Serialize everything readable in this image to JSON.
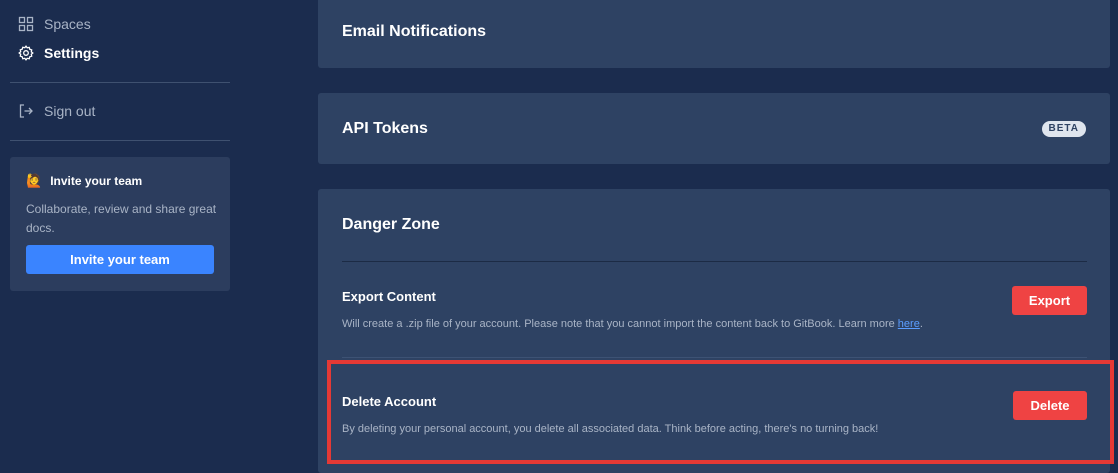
{
  "sidebar": {
    "items": [
      {
        "label": "Spaces",
        "icon": "grid-icon"
      },
      {
        "label": "Settings",
        "icon": "gear-icon",
        "active": true
      },
      {
        "label": "Sign out",
        "icon": "sign-out-icon"
      }
    ],
    "invite": {
      "emoji": "🙋",
      "title": "Invite your team",
      "description": "Collaborate, review and share great docs.",
      "button_label": "Invite your team"
    }
  },
  "main": {
    "email": {
      "title": "Email Notifications"
    },
    "api": {
      "title": "API Tokens",
      "badge": "BETA"
    },
    "danger": {
      "title": "Danger Zone",
      "export": {
        "title": "Export Content",
        "description": "Will create a .zip file of your account. Please note that you cannot import the content back to GitBook. Learn more ",
        "link": "here",
        "period": ".",
        "button_label": "Export"
      },
      "delete": {
        "title": "Delete Account",
        "description": "By deleting your personal account, you delete all associated data. Think before acting, there's no turning back!",
        "button_label": "Delete"
      }
    }
  },
  "colors": {
    "background": "#1b2c4e",
    "panel": "#2e4263",
    "accent": "#3a84ff",
    "danger": "#ef4343",
    "highlight": "#e53935"
  }
}
